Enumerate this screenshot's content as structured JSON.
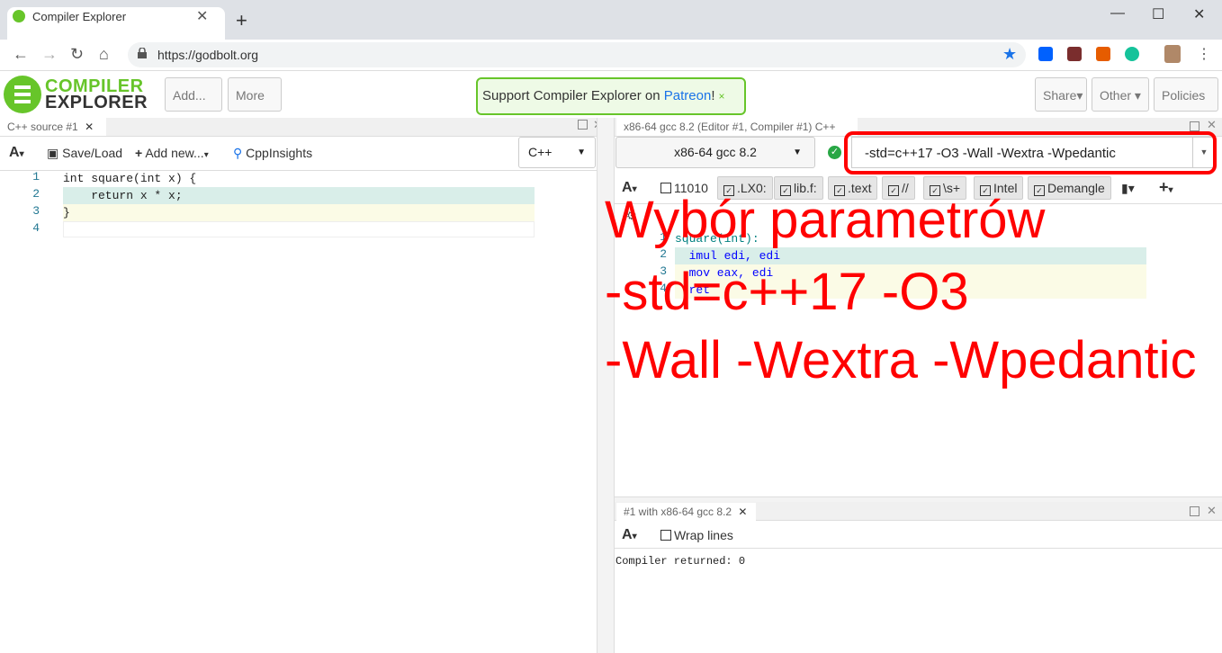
{
  "browser": {
    "tab_title": "Compiler Explorer",
    "new_tab": "+",
    "tab_close": "✕",
    "window_min": "—",
    "window_max": "☐",
    "window_close": "✕",
    "url": "https://godbolt.org"
  },
  "header": {
    "logo_line1": "COMPILER",
    "logo_line2": "EXPLORER",
    "add_label": "Add...",
    "more_label": "More",
    "patreon_text": "Support Compiler Explorer on ",
    "patreon_link": "Patreon",
    "patreon_suffix": "!",
    "patreon_close": "×",
    "share_label": "Share",
    "other_label": "Other",
    "policies_label": "Policies"
  },
  "editor": {
    "tab_label": "C++ source #1",
    "tab_close": "✕",
    "font_btn": "A",
    "save_load": "Save/Load",
    "add_new": "Add new...",
    "cppinsights": "CppInsights",
    "language": "C++",
    "lines": [
      {
        "num": "1",
        "text": "int square(int x) {"
      },
      {
        "num": "2",
        "text": "    return x * x;"
      },
      {
        "num": "3",
        "text": "}"
      },
      {
        "num": "4",
        "text": ""
      }
    ]
  },
  "compiler": {
    "tab_label": "x86-64 gcc 8.2 (Editor #1, Compiler #1) C++",
    "tab_close": "✕",
    "compiler_name": "x86-64 gcc 8.2",
    "options": "-std=c++17 -O3 -Wall -Wextra -Wpedantic",
    "filters": {
      "font_btn": "A",
      "binary": "11010",
      "lx0": ".LX0:",
      "libf": "lib.f:",
      "text": ".text",
      "comments": "//",
      "whitespace": "\\s+",
      "intel": "Intel",
      "demangle": "Demangle"
    },
    "asm_lines": [
      {
        "num": "1",
        "text": "square(int):"
      },
      {
        "num": "2",
        "text": "  imul edi, edi"
      },
      {
        "num": "3",
        "text": "  mov eax, edi"
      },
      {
        "num": "4",
        "text": "  ret"
      }
    ]
  },
  "output": {
    "tab_label": "#1 with x86-64 gcc 8.2",
    "tab_close": "✕",
    "font_btn": "A",
    "wrap_lines": "Wrap lines",
    "result": "Compiler returned: 0"
  },
  "annotation": {
    "line1": "Wybór parametrów",
    "line2": "-std=c++17 -O3",
    "line3": "-Wall -Wextra -Wpedantic",
    "color": "#ff0000"
  }
}
